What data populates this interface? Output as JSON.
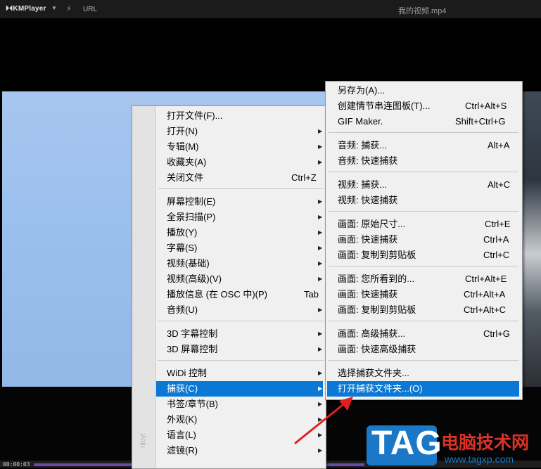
{
  "titlebar": {
    "app_name": "KMPlayer",
    "dropdown_icon": "chevron-down-icon",
    "bolt_icon": "lightning-icon",
    "url_label": "URL",
    "file_title": "我的视频.mp4"
  },
  "status": {
    "time": "00:00:03"
  },
  "main_menu": {
    "side_text": "njoy!",
    "items": [
      {
        "label": "打开文件(F)...",
        "shortcut": "",
        "arrow": ""
      },
      {
        "label": "打开(N)",
        "shortcut": "",
        "arrow": "▶"
      },
      {
        "label": "专辑(M)",
        "shortcut": "",
        "arrow": "▶"
      },
      {
        "label": "收藏夹(A)",
        "shortcut": "",
        "arrow": "▶"
      },
      {
        "label": "关闭文件",
        "shortcut": "Ctrl+Z",
        "arrow": ""
      },
      {
        "label": "屏幕控制(E)",
        "shortcut": "",
        "arrow": "▶"
      },
      {
        "label": "全景扫描(P)",
        "shortcut": "",
        "arrow": "▶"
      },
      {
        "label": "播放(Y)",
        "shortcut": "",
        "arrow": "▶"
      },
      {
        "label": "字幕(S)",
        "shortcut": "",
        "arrow": "▶"
      },
      {
        "label": "视频(基础)",
        "shortcut": "",
        "arrow": "▶"
      },
      {
        "label": "视频(高级)(V)",
        "shortcut": "",
        "arrow": "▶"
      },
      {
        "label": "播放信息 (在 OSC 中)(P)",
        "shortcut": "Tab",
        "arrow": ""
      },
      {
        "label": "音频(U)",
        "shortcut": "",
        "arrow": "▶"
      },
      {
        "label": "3D 字幕控制",
        "shortcut": "",
        "arrow": "▶"
      },
      {
        "label": "3D 屏幕控制",
        "shortcut": "",
        "arrow": "▶"
      },
      {
        "label": "WiDi 控制",
        "shortcut": "",
        "arrow": "▶"
      },
      {
        "label": "捕获(C)",
        "shortcut": "",
        "arrow": "▶"
      },
      {
        "label": "书签/章节(B)",
        "shortcut": "",
        "arrow": "▶"
      },
      {
        "label": "外观(K)",
        "shortcut": "",
        "arrow": "▶"
      },
      {
        "label": "语言(L)",
        "shortcut": "",
        "arrow": "▶"
      },
      {
        "label": "滤镜(R)",
        "shortcut": "",
        "arrow": "▶"
      }
    ]
  },
  "capture_menu": {
    "items": [
      {
        "label": "另存为(A)...",
        "shortcut": ""
      },
      {
        "label": "创建情节串连图板(T)...",
        "shortcut": "Ctrl+Alt+S"
      },
      {
        "label": "GIF Maker.",
        "shortcut": "Shift+Ctrl+G"
      },
      {
        "label": "音频: 捕获...",
        "shortcut": "Alt+A"
      },
      {
        "label": "音频: 快速捕获",
        "shortcut": ""
      },
      {
        "label": "视频: 捕获...",
        "shortcut": "Alt+C"
      },
      {
        "label": "视频: 快速捕获",
        "shortcut": ""
      },
      {
        "label": "画面: 原始尺寸...",
        "shortcut": "Ctrl+E"
      },
      {
        "label": "画面: 快速捕获",
        "shortcut": "Ctrl+A"
      },
      {
        "label": "画面: 复制到剪贴板",
        "shortcut": "Ctrl+C"
      },
      {
        "label": "画面: 您所看到的...",
        "shortcut": "Ctrl+Alt+E"
      },
      {
        "label": "画面: 快速捕获",
        "shortcut": "Ctrl+Alt+A"
      },
      {
        "label": "画面: 复制到剪贴板",
        "shortcut": "Ctrl+Alt+C"
      },
      {
        "label": "画面: 高级捕获...",
        "shortcut": "Ctrl+G"
      },
      {
        "label": "画面: 快速高级捕获",
        "shortcut": ""
      },
      {
        "label": "选择捕获文件夹...",
        "shortcut": ""
      },
      {
        "label": "打开捕获文件夹...(O)",
        "shortcut": ""
      }
    ]
  },
  "watermark": {
    "badge": "TAG",
    "title": "电脑技术网",
    "url": "www.tagxp.com"
  },
  "colors": {
    "highlight": "#0a78d4",
    "annotation_arrow": "#e02020",
    "watermark_blue": "#1a78c7",
    "watermark_red": "#d93327"
  }
}
